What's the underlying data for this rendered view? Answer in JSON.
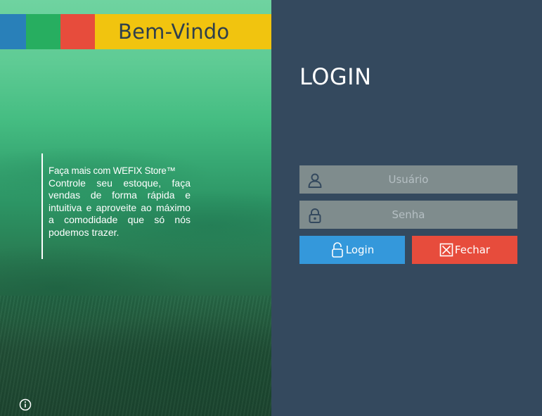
{
  "header": {
    "welcome_text": "Bem-Vindo",
    "colors": [
      "#2980b9",
      "#27ae60",
      "#e74c3c",
      "#f1c40f"
    ]
  },
  "promo": {
    "line1": "Faça mais com WEFIX Store™",
    "body": "Controle seu estoque, faça vendas de forma rápida e intuitiva e aproveite ao máximo a comodidade que só nós podemos trazer."
  },
  "login": {
    "title": "LOGIN",
    "username": {
      "value": "",
      "placeholder": "Usuário",
      "icon": "user-icon"
    },
    "password": {
      "value": "",
      "placeholder": "Senha",
      "icon": "lock-icon"
    },
    "login_button": {
      "label": "Login",
      "icon": "unlock-icon",
      "color": "#3498db"
    },
    "close_button": {
      "label": "Fechar",
      "icon": "close-box-icon",
      "color": "#e74c3c"
    }
  },
  "footer": {
    "icon": "info-icon"
  },
  "theme": {
    "panel_bg": "#34495e",
    "field_bg": "#7f8c8d"
  }
}
